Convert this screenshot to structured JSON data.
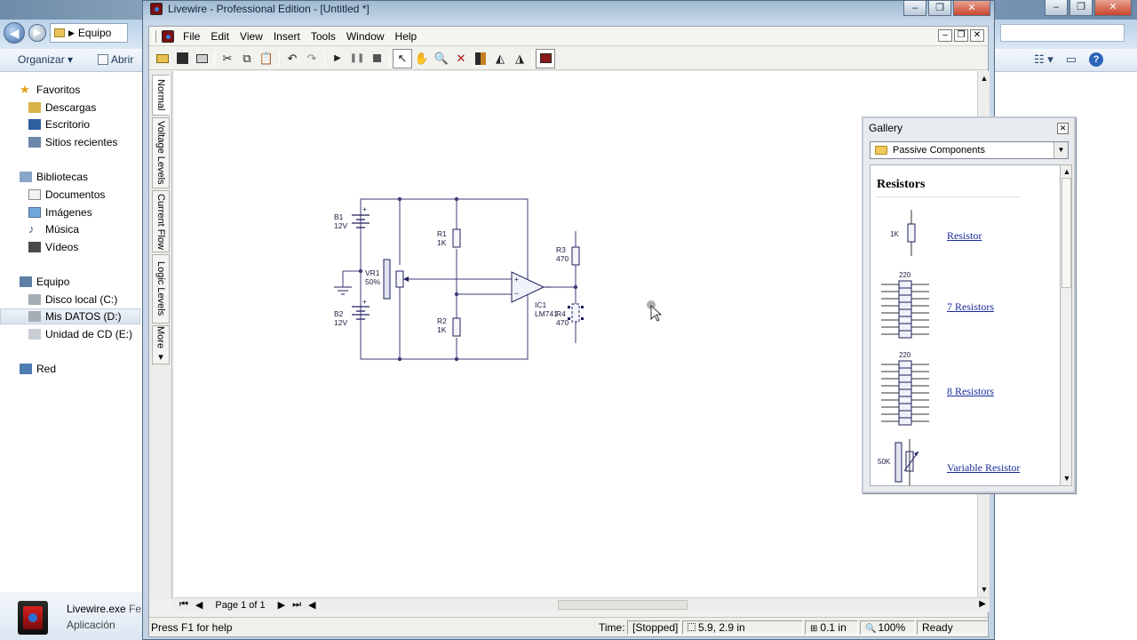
{
  "explorer": {
    "address": "Equipo",
    "toolbar": {
      "organize": "Organizar ▾",
      "open": "Abrir"
    },
    "nav": {
      "favorites": "Favoritos",
      "downloads": "Descargas",
      "desktop": "Escritorio",
      "recent": "Sitios recientes",
      "libraries": "Bibliotecas",
      "documents": "Documentos",
      "images": "Imágenes",
      "music": "Música",
      "videos": "Vídeos",
      "computer": "Equipo",
      "disk_c": "Disco local (C:)",
      "disk_d": "Mis DATOS (D:)",
      "cd_e": "Unidad de CD (E:)",
      "network": "Red"
    },
    "details": {
      "name": "Livewire.exe",
      "type": "Aplicación",
      "extra": "Fe"
    }
  },
  "app": {
    "title": "Livewire - Professional Edition - [Untitled *]",
    "menu": [
      "File",
      "Edit",
      "View",
      "Insert",
      "Tools",
      "Window",
      "Help"
    ],
    "side_tabs": [
      "Normal",
      "Voltage Levels",
      "Current Flow",
      "Logic Levels",
      "More ▾"
    ],
    "page_indicator": "Page 1 of 1",
    "status": {
      "help": "Press F1 for help",
      "time_label": "Time:",
      "time_value": "[Stopped]",
      "coords": "5.9, 2.9 in",
      "grid": "0.1 in",
      "zoom": "100%",
      "ready": "Ready"
    }
  },
  "circuit": {
    "b1_name": "B1",
    "b1_value": "12V",
    "b2_name": "B2",
    "b2_value": "12V",
    "vr1_name": "VR1",
    "vr1_value": "50%",
    "r1_name": "R1",
    "r1_value": "1K",
    "r2_name": "R2",
    "r2_value": "1K",
    "r3_name": "R3",
    "r3_value": "470",
    "r4_name": "R4",
    "r4_value": "470",
    "ic1_name": "IC1",
    "ic1_part": "LM741",
    "plus": "+",
    "minus": "−"
  },
  "gallery": {
    "title": "Gallery",
    "category": "Passive Components",
    "heading": "Resistors",
    "items": [
      {
        "label": "Resistor",
        "caption": "1K"
      },
      {
        "label": "7 Resistors",
        "caption": "220"
      },
      {
        "label": "8 Resistors",
        "caption": "220"
      },
      {
        "label": "Variable Resistor",
        "caption": "50K"
      }
    ]
  },
  "colors": {
    "wire": "#3b3b7a",
    "component": "#1f1f5c",
    "link": "#1a2a9a",
    "title_gradient": "#9fb8d1"
  }
}
